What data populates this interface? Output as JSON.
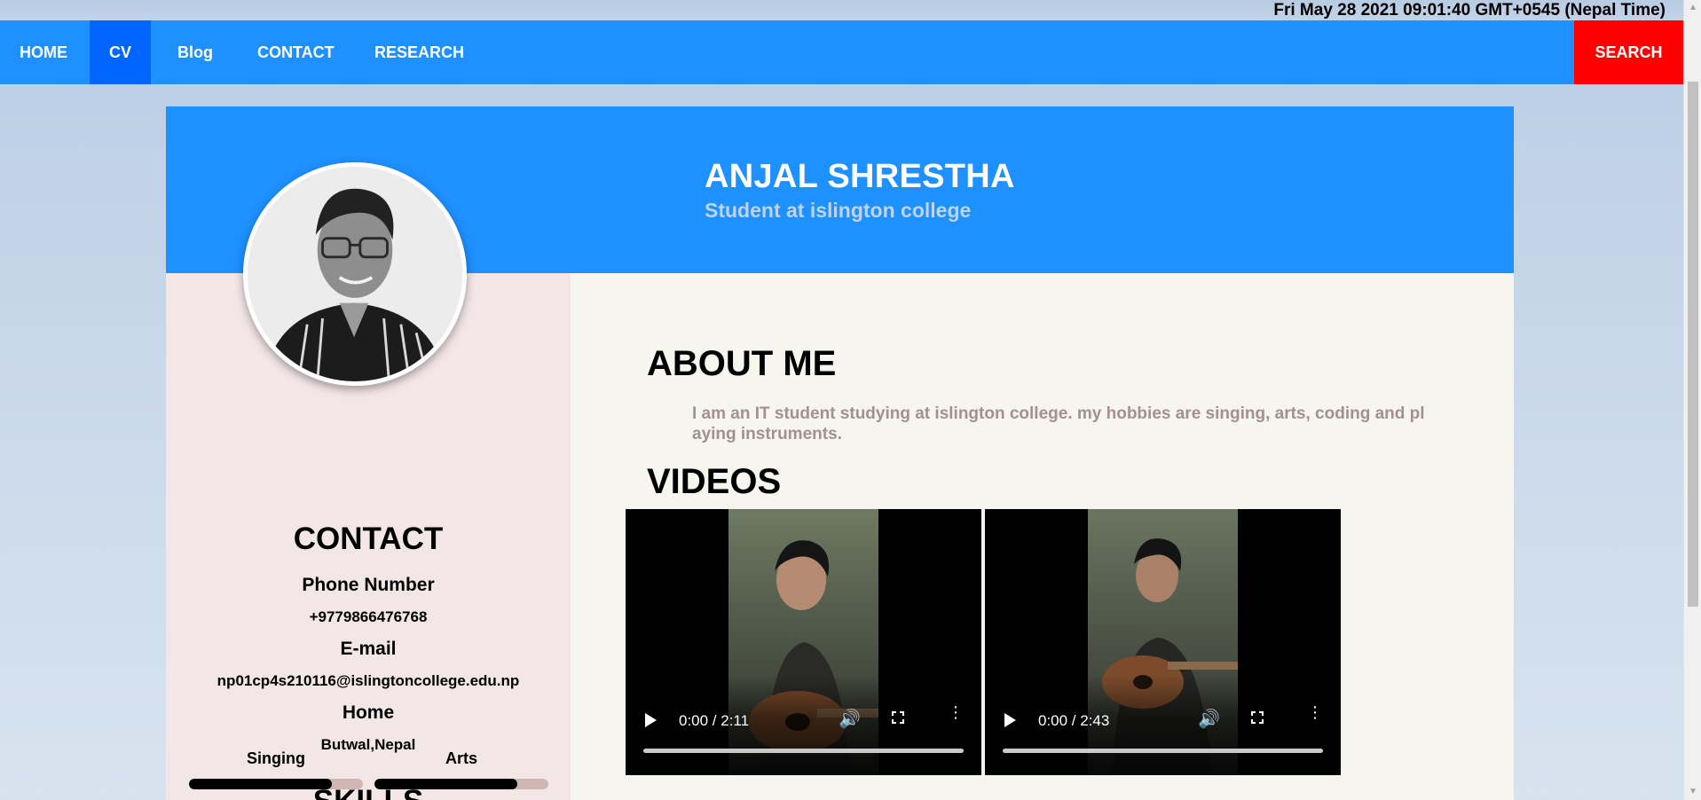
{
  "clock": "Fri May 28 2021 09:01:40 GMT+0545 (Nepal Time)",
  "nav": {
    "items": [
      "HOME",
      "CV",
      "Blog",
      "CONTACT",
      "RESEARCH"
    ],
    "active": "CV",
    "search_label": "SEARCH"
  },
  "colors": {
    "nav": "#1e90ff",
    "nav_active": "#0066ff",
    "search": "#ff0000",
    "sidebar": "#f3e6e7",
    "main": "#f6f5ee"
  },
  "header": {
    "name": "ANJAL SHRESTHA",
    "subtitle": "Student at islington college"
  },
  "sidebar": {
    "avatar_icon": "profile-photo",
    "contact_heading": "CONTACT",
    "phone_label": "Phone Number",
    "phone": "+9779866476768",
    "email_label": "E-mail",
    "email": "np01cp4s210116@islingtoncollege.edu.np",
    "home_label": "Home",
    "home": "Butwal,Nepal",
    "skills_heading": "SKILLS",
    "skills": [
      {
        "name": "Singing",
        "level": 0.82
      },
      {
        "name": "Arts",
        "level": 0.82
      }
    ]
  },
  "main": {
    "about_heading": "ABOUT ME",
    "about_text": "I am an IT student studying at islington college. my hobbies are singing, arts, coding and pl aying instruments.",
    "videos_heading": "VIDEOS",
    "videos": [
      {
        "time": "0:00 / 2:11",
        "progress": 0
      },
      {
        "time": "0:00 / 2:43",
        "progress": 0
      }
    ]
  }
}
